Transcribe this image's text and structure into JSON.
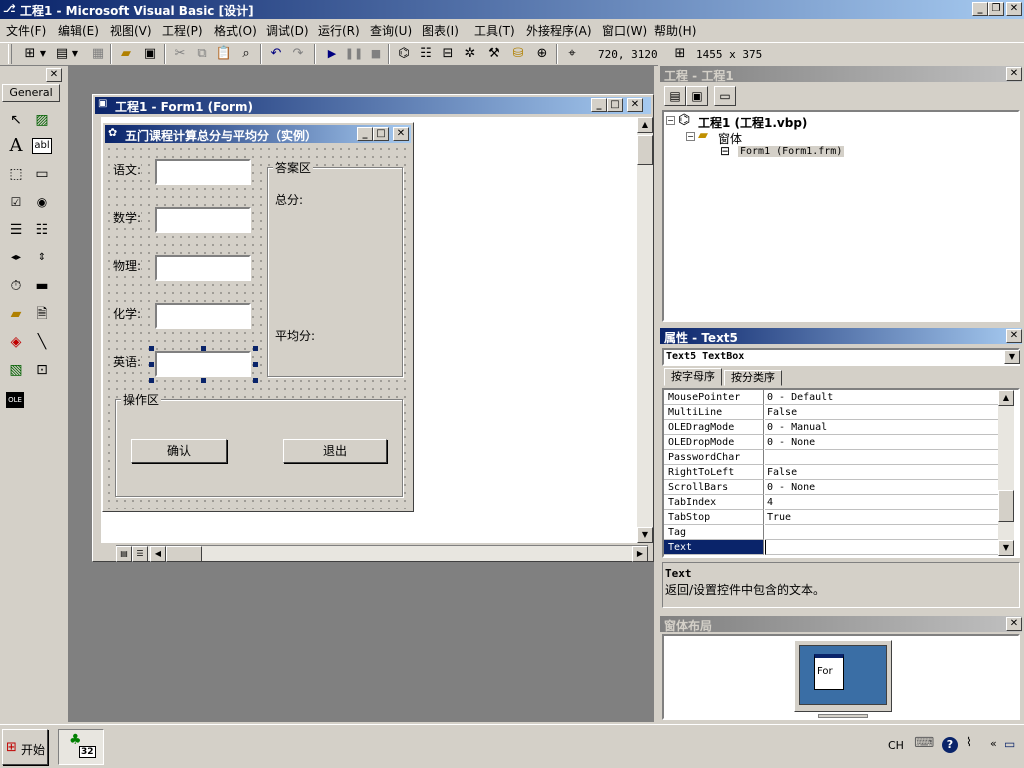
{
  "app": {
    "title": "工程1 - Microsoft Visual Basic [设计]",
    "title_icon": "vb-icon",
    "colors": {
      "titlebar": "#0a246a",
      "titlebar_end": "#a6caf0",
      "workspace": "#808080",
      "face": "#d4d0c8",
      "form_title": "#0a246a",
      "selection": "#0a246a"
    }
  },
  "menu": [
    "文件(F)",
    "编辑(E)",
    "视图(V)",
    "工程(P)",
    "格式(O)",
    "调试(D)",
    "运行(R)",
    "查询(U)",
    "图表(I)",
    "工具(T)",
    "外接程序(A)",
    "窗口(W)",
    "帮助(H)"
  ],
  "toolbar": {
    "position": "720, 3120",
    "size": "1455 x 375"
  },
  "toolbox": {
    "tab": "General",
    "tools": [
      "pointer",
      "picturebox",
      "label",
      "textbox",
      "frame",
      "commandbutton",
      "checkbox",
      "optionbutton",
      "combobox",
      "listbox",
      "hscrollbar",
      "vscrollbar",
      "timer",
      "drivelistbox",
      "dirlistbox",
      "filelistbox",
      "shape",
      "line",
      "image",
      "data",
      "ole"
    ],
    "label_glyph": "A",
    "textbox_glyph": "abl",
    "ole_glyph": "OLE"
  },
  "designer": {
    "title": "工程1 - Form1 (Form)"
  },
  "form": {
    "caption": "五门课程计算总分与平均分（实例）",
    "labels": [
      "语文:",
      "数学:",
      "物理:",
      "化学:",
      "英语:"
    ],
    "answer_frame": "答案区",
    "total_label": "总分:",
    "average_label": "平均分:",
    "op_frame": "操作区",
    "confirm": "确认",
    "exit": "退出"
  },
  "project": {
    "title": "工程 - 工程1",
    "root": "工程1 (工程1.vbp)",
    "folder": "窗体",
    "item": "Form1 (Form1.frm)"
  },
  "properties": {
    "title": "属性 - Text5",
    "object": "Text5 TextBox",
    "tab_alpha": "按字母序",
    "tab_category": "按分类序",
    "rows": [
      {
        "name": "MousePointer",
        "value": "0 - Default"
      },
      {
        "name": "MultiLine",
        "value": "False"
      },
      {
        "name": "OLEDragMode",
        "value": "0 - Manual"
      },
      {
        "name": "OLEDropMode",
        "value": "0 - None"
      },
      {
        "name": "PasswordChar",
        "value": ""
      },
      {
        "name": "RightToLeft",
        "value": "False"
      },
      {
        "name": "ScrollBars",
        "value": "0 - None"
      },
      {
        "name": "TabIndex",
        "value": "4"
      },
      {
        "name": "TabStop",
        "value": "True"
      },
      {
        "name": "Tag",
        "value": ""
      },
      {
        "name": "Text",
        "value": ""
      }
    ],
    "desc_title": "Text",
    "desc_text": "返回/设置控件中包含的文本。"
  },
  "layout_window": {
    "title": "窗体布局",
    "preview": "For"
  },
  "taskbar": {
    "start": "开始",
    "lang": "CH",
    "app_badge": "32"
  }
}
